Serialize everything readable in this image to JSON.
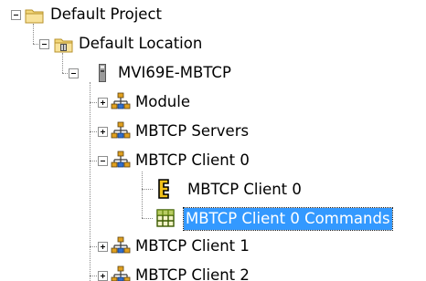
{
  "tree": {
    "nodes": [
      {
        "label": "Default Project",
        "icon": "folder-icon",
        "state": "expanded"
      },
      {
        "label": "Default Location",
        "icon": "location-folder-icon",
        "state": "expanded"
      },
      {
        "label": "MVI69E-MBTCP",
        "icon": "module-card-icon",
        "state": "expanded"
      },
      {
        "label": "Module",
        "icon": "network-nodes-icon",
        "state": "collapsed"
      },
      {
        "label": "MBTCP Servers",
        "icon": "network-nodes-icon",
        "state": "collapsed"
      },
      {
        "label": "MBTCP Client 0",
        "icon": "network-nodes-icon",
        "state": "expanded"
      },
      {
        "label": "MBTCP Client 0",
        "icon": "config-bracket-icon",
        "state": "leaf"
      },
      {
        "label": "MBTCP Client 0 Commands",
        "icon": "grid-table-icon",
        "state": "leaf",
        "selected": true
      },
      {
        "label": "MBTCP Client 1",
        "icon": "network-nodes-icon",
        "state": "collapsed"
      },
      {
        "label": "MBTCP Client 2",
        "icon": "network-nodes-icon",
        "state": "collapsed"
      }
    ]
  },
  "colors": {
    "selection": "#3399ff",
    "folder": "#f3d77a",
    "network_node": "#e0a020"
  }
}
